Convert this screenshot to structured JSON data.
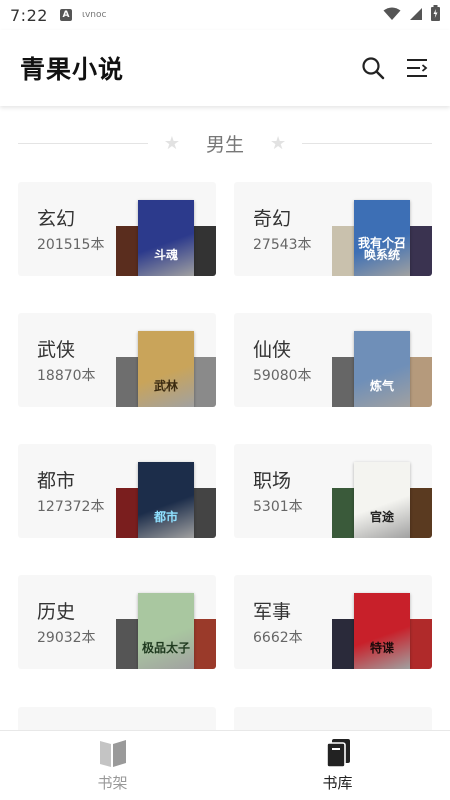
{
  "status_bar": {
    "time": "7:22",
    "app_icon": "A",
    "mini_text": "ιvnoc"
  },
  "app_bar": {
    "title": "青果小说",
    "search_icon": "search-icon",
    "menu_icon": "menu-icon"
  },
  "section": {
    "label": "男生"
  },
  "categories": [
    {
      "name": "玄幻",
      "count": "201515本",
      "cover": {
        "text": "斗魂"
      },
      "colors": {
        "main": "#2c3a8c",
        "left": "#5a2d1e",
        "right": "#333333",
        "text": "#ffffff"
      }
    },
    {
      "name": "奇幻",
      "count": "27543本",
      "cover": {
        "text": "我有个召唤系统"
      },
      "colors": {
        "main": "#3d6fb5",
        "left": "#c9c1ad",
        "right": "#3a3350",
        "text": "#ffffff"
      }
    },
    {
      "name": "武侠",
      "count": "18870本",
      "cover": {
        "text": "武林"
      },
      "colors": {
        "main": "#c9a45a",
        "left": "#6e6e6e",
        "right": "#8a8a8a",
        "text": "#3a2a10"
      }
    },
    {
      "name": "仙侠",
      "count": "59080本",
      "cover": {
        "text": "炼气"
      },
      "colors": {
        "main": "#6f8fb8",
        "left": "#666666",
        "right": "#b59a7c",
        "text": "#ffffff"
      }
    },
    {
      "name": "都市",
      "count": "127372本",
      "cover": {
        "text": "都市"
      },
      "colors": {
        "main": "#1c2d4a",
        "left": "#7a1e1e",
        "right": "#444444",
        "text": "#8fe0ff"
      }
    },
    {
      "name": "职场",
      "count": "5301本",
      "cover": {
        "text": "官途"
      },
      "colors": {
        "main": "#f4f4f0",
        "left": "#3a5a3a",
        "right": "#5a3a20",
        "text": "#222222"
      }
    },
    {
      "name": "历史",
      "count": "29032本",
      "cover": {
        "text": "极品太子"
      },
      "colors": {
        "main": "#a9c7a0",
        "left": "#555555",
        "right": "#9a3a2a",
        "text": "#1f3a1f"
      }
    },
    {
      "name": "军事",
      "count": "6662本",
      "cover": {
        "text": "特谍"
      },
      "colors": {
        "main": "#c8202a",
        "left": "#2a2a3a",
        "right": "#b02a2a",
        "text": "#1a0a0a"
      }
    }
  ],
  "bottom_nav": [
    {
      "label": "书架",
      "icon": "book-open-icon",
      "active": false
    },
    {
      "label": "书库",
      "icon": "library-icon",
      "active": true
    }
  ],
  "colors": {
    "active": "#222222",
    "inactive": "#999999"
  }
}
